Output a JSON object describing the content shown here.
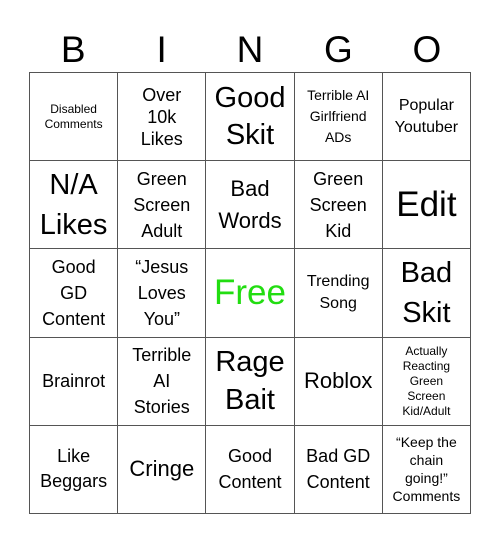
{
  "header": {
    "letters": [
      "B",
      "I",
      "N",
      "G",
      "O"
    ]
  },
  "free_color": "#22dd11",
  "cells": [
    [
      "Disabled Comments",
      "Over 10k Likes",
      "Good Skit",
      "Terrible AI Girlfriend ADs",
      "Popular Youtuber"
    ],
    [
      "N/A Likes",
      "Green Screen Adult",
      "Bad Words",
      "Green Screen Kid",
      "Edit"
    ],
    [
      "Good GD Content",
      "“Jesus Loves You”",
      "Free",
      "Trending Song",
      "Bad Skit"
    ],
    [
      "Brainrot",
      "Terrible AI Stories",
      "Rage Bait",
      "Roblox",
      "Actually Reacting Green Screen Kid/Adult"
    ],
    [
      "Like Beggars",
      "Cringe",
      "Good Content",
      "Bad GD Content",
      "“Keep the chain going!” Comments"
    ]
  ]
}
